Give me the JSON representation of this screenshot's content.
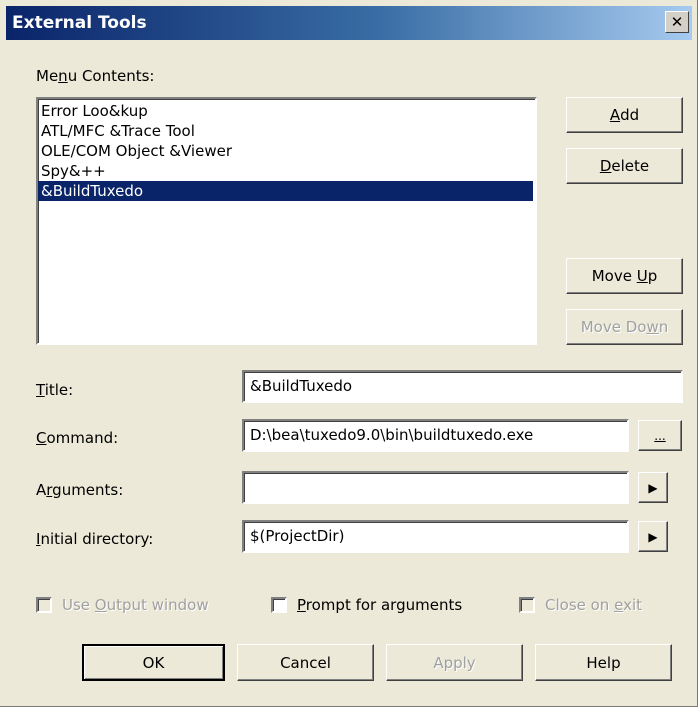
{
  "dialog": {
    "title": "External Tools",
    "close_glyph": "✕"
  },
  "menu_contents": {
    "label_pre": "Me",
    "label_u": "n",
    "label_post": "u Contents:",
    "items": [
      "Error Loo&kup",
      "ATL/MFC &Trace Tool",
      "OLE/COM Object &Viewer",
      "Spy&++",
      "&BuildTuxedo"
    ],
    "selected_index": 4
  },
  "side_buttons": {
    "add": {
      "pre": "",
      "u": "A",
      "post": "dd"
    },
    "delete": {
      "pre": "",
      "u": "D",
      "post": "elete"
    },
    "move_up": {
      "pre": "Move ",
      "u": "U",
      "post": "p"
    },
    "move_down": {
      "pre": "Move Do",
      "u": "w",
      "post": "n"
    }
  },
  "fields": {
    "title": {
      "label_u": "T",
      "label_post": "itle:",
      "value": "&BuildTuxedo"
    },
    "command": {
      "label_u": "C",
      "label_post": "ommand:",
      "value": "D:\\bea\\tuxedo9.0\\bin\\buildtuxedo.exe",
      "browse_label": "..."
    },
    "arguments": {
      "label_pre": "A",
      "label_u": "r",
      "label_post": "guments:",
      "value": "",
      "arrow_glyph": "▶"
    },
    "initial_directory": {
      "label_u": "I",
      "label_post": "nitial directory:",
      "value": "$(ProjectDir)",
      "arrow_glyph": "▶"
    }
  },
  "options": {
    "use_output_window": {
      "pre": "Use ",
      "u": "O",
      "post": "utput window",
      "checked": false,
      "enabled": false
    },
    "prompt_for_arguments": {
      "pre": "",
      "u": "P",
      "post": "rompt for arguments",
      "checked": false,
      "enabled": true
    },
    "close_on_exit": {
      "pre": "Close on ",
      "u": "e",
      "post": "xit",
      "checked": false,
      "enabled": false
    }
  },
  "footer_buttons": {
    "ok": "OK",
    "cancel": "Cancel",
    "apply": "Apply",
    "help": "Help"
  }
}
